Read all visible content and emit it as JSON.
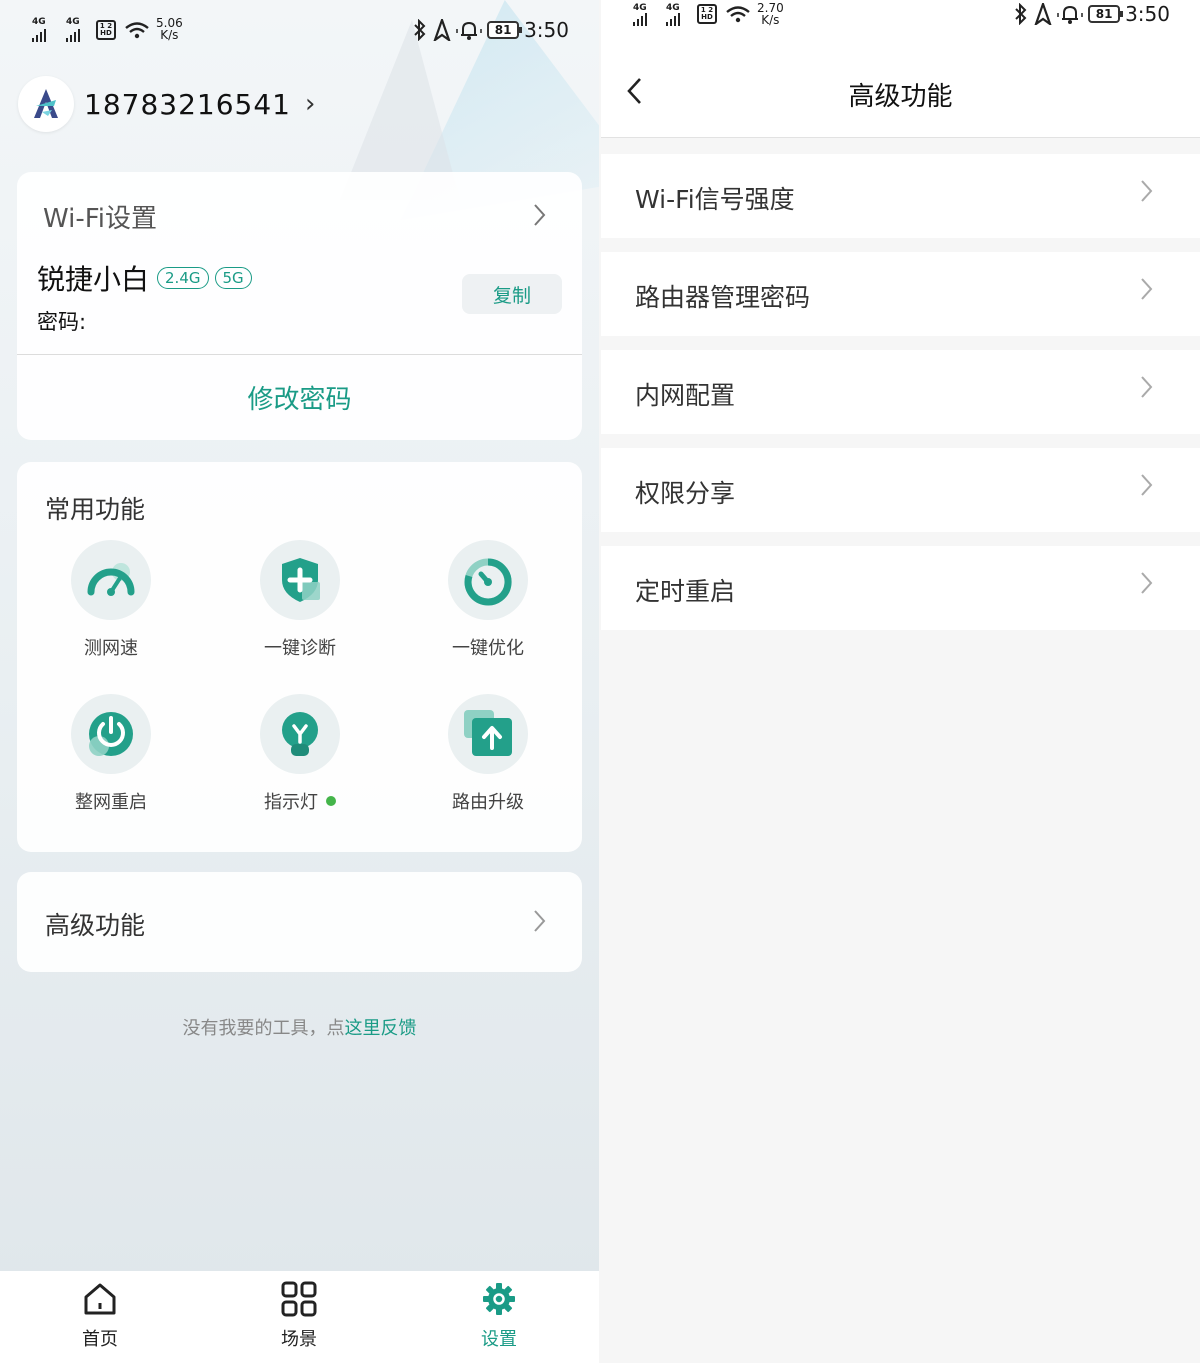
{
  "left_status": {
    "sig1": "4G",
    "sig2": "4G",
    "hd_top": "1 2",
    "hd_bottom": "HD",
    "speed_value": "5.06",
    "speed_unit": "K/s",
    "battery": "81",
    "time": "3:50"
  },
  "right_status": {
    "sig1": "4G",
    "sig2": "4G",
    "hd_top": "1 2",
    "hd_bottom": "HD",
    "speed_value": "2.70",
    "speed_unit": "K/s",
    "battery": "81",
    "time": "3:50"
  },
  "profile": {
    "phone": "18783216541",
    "chevron": "›"
  },
  "wifi_card": {
    "title": "Wi-Fi设置",
    "ssid": "锐捷小白",
    "bands": [
      "2.4G",
      "5G"
    ],
    "password_label": "密码:",
    "copy_label": "复制",
    "change_password_label": "修改密码"
  },
  "functions": {
    "title": "常用功能",
    "items": [
      {
        "label": "测网速",
        "icon": "speedometer-icon"
      },
      {
        "label": "一键诊断",
        "icon": "shield-plus-icon"
      },
      {
        "label": "一键优化",
        "icon": "timer-icon"
      },
      {
        "label": "整网重启",
        "icon": "power-icon"
      },
      {
        "label": "指示灯",
        "icon": "bulb-icon",
        "status_dot": true
      },
      {
        "label": "路由升级",
        "icon": "upload-icon"
      }
    ]
  },
  "advanced_card": {
    "title": "高级功能"
  },
  "feedback": {
    "text": "没有我要的工具，点",
    "link": "这里反馈"
  },
  "tabs": [
    {
      "label": "首页",
      "icon": "home-icon",
      "active": false
    },
    {
      "label": "场景",
      "icon": "grid-icon",
      "active": false
    },
    {
      "label": "设置",
      "icon": "gear-icon",
      "active": true
    }
  ],
  "right_nav": {
    "title": "高级功能",
    "back": "‹"
  },
  "advanced_items": [
    {
      "label": "Wi-Fi信号强度"
    },
    {
      "label": "路由器管理密码"
    },
    {
      "label": "内网配置"
    },
    {
      "label": "权限分享"
    },
    {
      "label": "定时重启"
    }
  ],
  "colors": {
    "accent": "#1a9b86",
    "accent_light": "#5cc3b0",
    "status_dot": "#44b54a"
  }
}
